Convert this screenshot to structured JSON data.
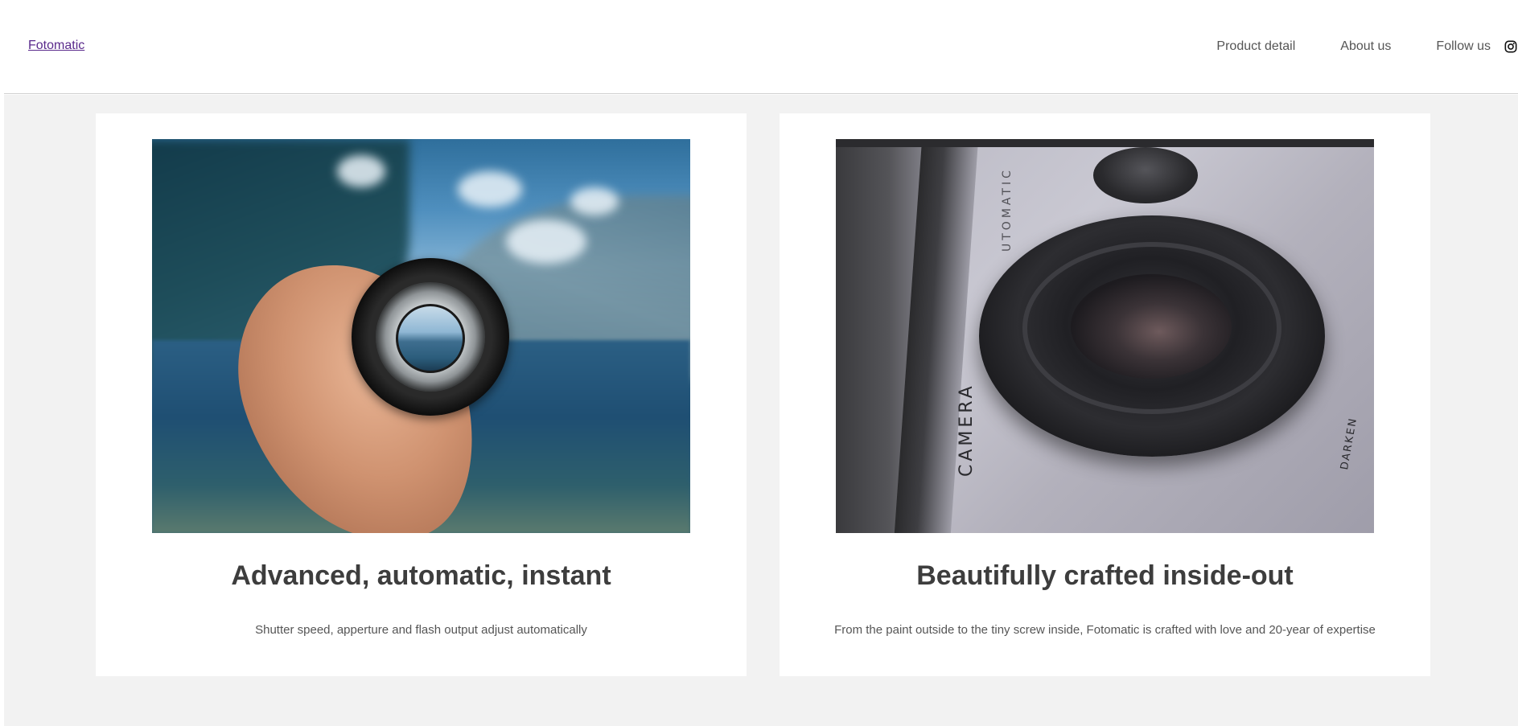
{
  "header": {
    "logo": "Fotomatic",
    "nav": [
      {
        "label": "Product detail"
      },
      {
        "label": "About us"
      },
      {
        "label": "Follow us",
        "icon": "instagram-icon"
      }
    ]
  },
  "cards": [
    {
      "image_alt": "hand holding camera lens over lake",
      "title": "Advanced, automatic, instant",
      "description": "Shutter speed, apperture and flash output adjust automatically"
    },
    {
      "image_alt": "vintage camera lens close-up",
      "title": "Beautifully crafted inside-out",
      "description": "From the paint outside to the tiny screw inside, Fotomatic is crafted with love and 20-year of expertise"
    }
  ],
  "photo_text": {
    "camera": "CAMERA",
    "automatic": "UTOMATIC",
    "darken": "DARKEN"
  },
  "colors": {
    "logo_link": "#5a2a8c",
    "main_bg": "#f2f2f2",
    "card_bg": "#ffffff",
    "title": "#3d3d3d",
    "text": "#555555"
  }
}
